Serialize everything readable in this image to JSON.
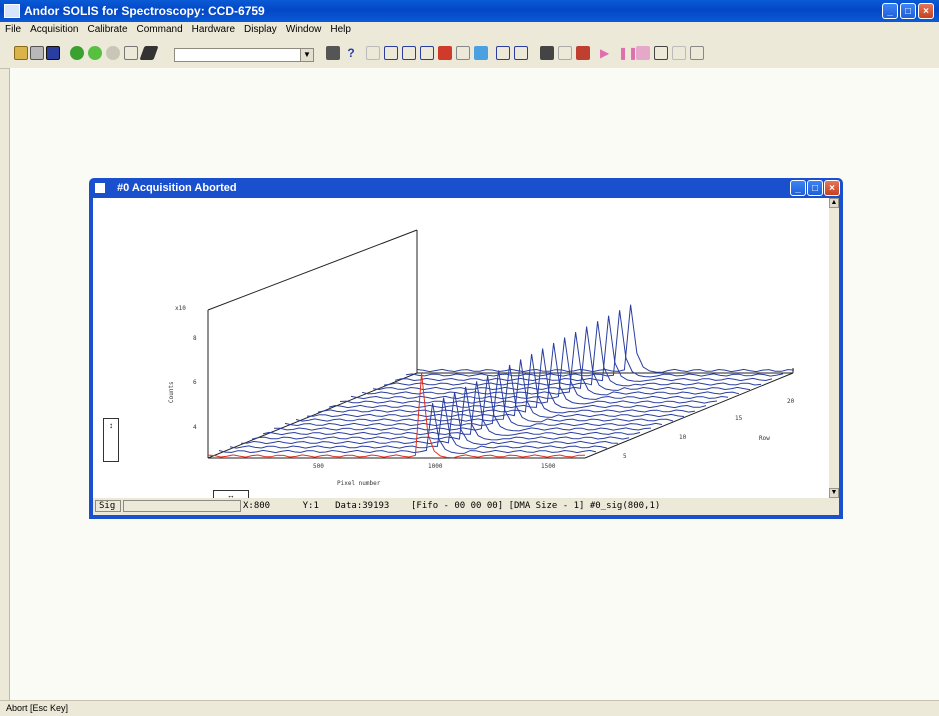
{
  "app": {
    "title": "Andor SOLIS for Spectroscopy: CCD-6759"
  },
  "menu": [
    "File",
    "Acquisition",
    "Calibrate",
    "Command",
    "Hardware",
    "Display",
    "Window",
    "Help"
  ],
  "toolbar": {
    "icons": [
      "open-icon",
      "print-icon",
      "save-icon",
      "acquire-green-icon",
      "autoscale-green-icon",
      "run-icon",
      "undo-icon",
      "wand-icon",
      "combo",
      "properties-icon",
      "help-icon",
      "zoom-icon",
      "scale-x-icon",
      "scale-y-icon",
      "scale-both-icon",
      "peak-icon",
      "colors-icon",
      "display-mode-icon",
      "3d-icon",
      "overlay-icon",
      "image-icon",
      "region-icon",
      "spool-icon",
      "play-icon",
      "pause-icon",
      "stop-icon",
      "kinetic-icon",
      "unlink-icon",
      "tools-icon"
    ],
    "combo_value": ""
  },
  "child": {
    "title": "#0 Acquisition Aborted",
    "status": {
      "signal": "Sig",
      "x": "X:800",
      "y": "Y:1",
      "data": "Data:39193",
      "fifo": "[Fifo - 00 00 00]",
      "dma": "[DMA Size - 1]",
      "ref": "#0_sig(800,1)"
    }
  },
  "statusbar": {
    "text": "Abort [Esc Key]"
  },
  "chart_data": {
    "type": "3d-waterfall",
    "xlabel": "Pixel number",
    "ylabel": "Counts",
    "zlabel": "Row",
    "yscale_label": "x10",
    "x_ticks": [
      "500",
      "1000",
      "1500"
    ],
    "y_ticks": [
      "4",
      "6",
      "8"
    ],
    "z_ticks": [
      "5",
      "10",
      "15",
      "20"
    ],
    "rows": 20,
    "peak_pixel": 800,
    "highlight_row": 1,
    "colors": {
      "traces": "#2a3ea0",
      "highlight": "#e03020"
    }
  }
}
